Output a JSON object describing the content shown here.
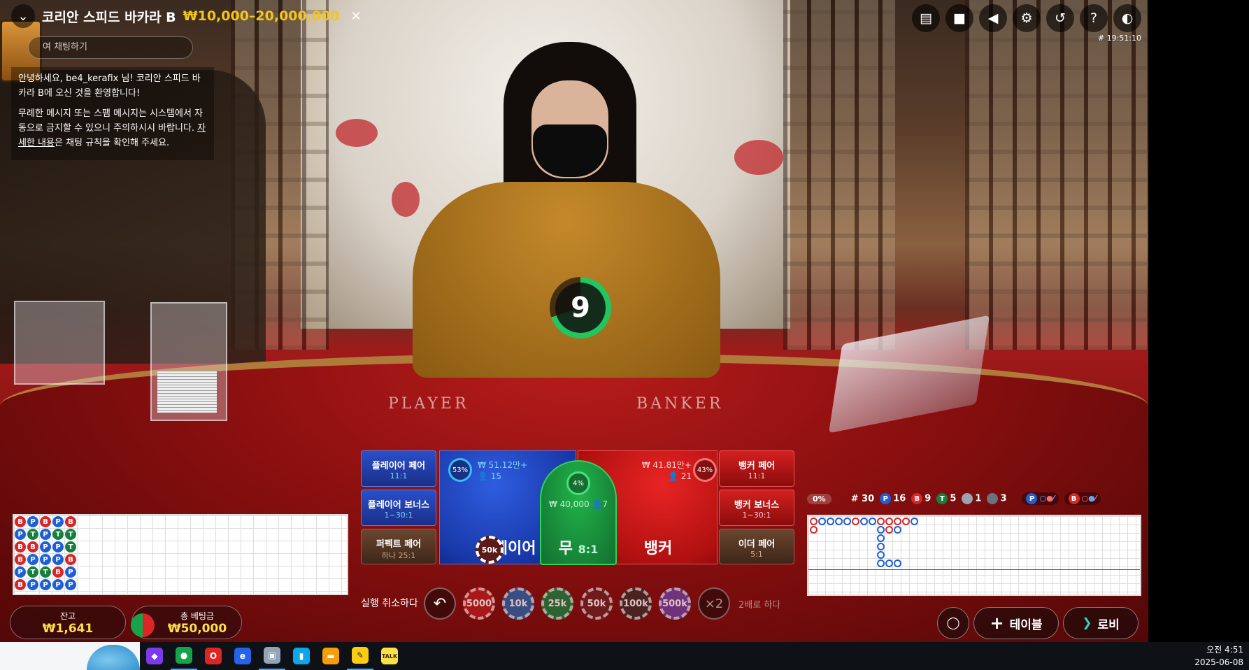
{
  "header": {
    "back_icon": "chevron-down-icon",
    "table_name": "코리안 스피드 바카라 B",
    "limits": "₩10,000–20,000,000",
    "close_glyph": "✕",
    "round_id": "# 19:51:10"
  },
  "toolbar": {
    "icons": [
      "chat-icon",
      "video-icon",
      "volume-icon",
      "gear-icon",
      "history-icon",
      "help-icon",
      "connection-icon"
    ]
  },
  "chat": {
    "input_placeholder": "여 채팅하기",
    "welcome": "안녕하세요, be4_kerafix 님! 코리안 스피드 바카라 B에 오신 것을 환영합니다!",
    "warning_prefix": "무례한 메시지 또는 스팸 메시지는 시스템에서 자동으로 금지할 수 있으니 주의하시시 바랍니다. ",
    "warning_link": "자세한 내용",
    "warning_suffix": "은 채팅 규칙을 확인해 주세요."
  },
  "felt": {
    "player": "PLAYER",
    "banker": "BANKER"
  },
  "timer": {
    "seconds": "9",
    "remaining_fraction": 0.7,
    "color": "#22c55e"
  },
  "bets": {
    "player_pair": {
      "label": "플레이어 페어",
      "odds": "11:1"
    },
    "player_bonus": {
      "label": "플레이어 보너스",
      "odds": "1~30:1"
    },
    "perfect_pair": {
      "label": "퍼펙트 페어",
      "odds": "하나 25:1"
    },
    "banker_pair": {
      "label": "뱅커 페어",
      "odds": "11:1"
    },
    "banker_bonus": {
      "label": "뱅커 보너스",
      "odds": "1~30:1"
    },
    "either_pair": {
      "label": "이더 페어",
      "odds": "5:1"
    },
    "player": {
      "label": "플레이어",
      "pct": "53%",
      "amount": "₩ 51.12만+",
      "players": "15"
    },
    "tie": {
      "label": "무",
      "odds": "8:1",
      "pct": "4%",
      "amount": "₩ 40,000",
      "players": "7"
    },
    "banker": {
      "label": "뱅커",
      "pct": "43%",
      "amount": "₩ 41.81만+",
      "players": "21"
    },
    "placed_chip": "50k"
  },
  "controls": {
    "undo_label": "실행 취소하다",
    "chips": [
      {
        "label": "5000",
        "color": "#b91c1c"
      },
      {
        "label": "10k",
        "color": "#2563a8"
      },
      {
        "label": "25k",
        "color": "#15803d"
      },
      {
        "label": "50k",
        "color": "#6b2020"
      },
      {
        "label": "100k",
        "color": "#3a2a2a"
      },
      {
        "label": "500k",
        "color": "#6b3fa0"
      }
    ],
    "double_glyph": "×2",
    "double_label": "2배로 하다"
  },
  "balance": {
    "label": "잔고",
    "value": "₩1,641"
  },
  "total_bet": {
    "label": "총 베팅금",
    "value": "₩50,000"
  },
  "bead_road": {
    "columns": [
      [
        "B",
        "P",
        "B",
        "B",
        "P",
        "B"
      ],
      [
        "P",
        "T",
        "B",
        "P",
        "T",
        "P"
      ],
      [
        "B",
        "P",
        "P",
        "P",
        "T",
        "P"
      ],
      [
        "P",
        "T",
        "P",
        "P",
        "B",
        "P"
      ],
      [
        "B",
        "T",
        "T",
        "B",
        "P",
        "P"
      ]
    ],
    "colors": {
      "B": "#d62828",
      "P": "#1f5fd6",
      "T": "#15803d"
    }
  },
  "road_stats": {
    "progress": "0%",
    "rounds": "# 30",
    "player_count": "16",
    "banker_count": "9",
    "tie_count": "5",
    "player_pair_count": "1",
    "banker_pair_count": "3",
    "player_predict": "P",
    "banker_predict": "B"
  },
  "buttons": {
    "tables_label": "테이블",
    "lobby_label": "로비"
  },
  "taskbar": {
    "apps": [
      {
        "icon": "copilot-icon",
        "glyph": "◆",
        "color": "#7c3aed"
      },
      {
        "icon": "chrome-icon",
        "glyph": "●",
        "color": "#16a34a"
      },
      {
        "icon": "opera-icon",
        "glyph": "O",
        "color": "#dc2626"
      },
      {
        "icon": "ie-icon",
        "glyph": "e",
        "color": "#2563eb"
      },
      {
        "icon": "remote-icon",
        "glyph": "▣",
        "color": "#94a3b8"
      },
      {
        "icon": "book-icon",
        "glyph": "▮",
        "color": "#0ea5e9"
      },
      {
        "icon": "folder-icon",
        "glyph": "▬",
        "color": "#f59e0b"
      },
      {
        "icon": "notes-icon",
        "glyph": "✎",
        "color": "#facc15"
      },
      {
        "icon": "kakaotalk-icon",
        "glyph": "TALK",
        "color": "#fde047"
      }
    ],
    "time": "오전 4:51",
    "date": "2025-06-08"
  }
}
